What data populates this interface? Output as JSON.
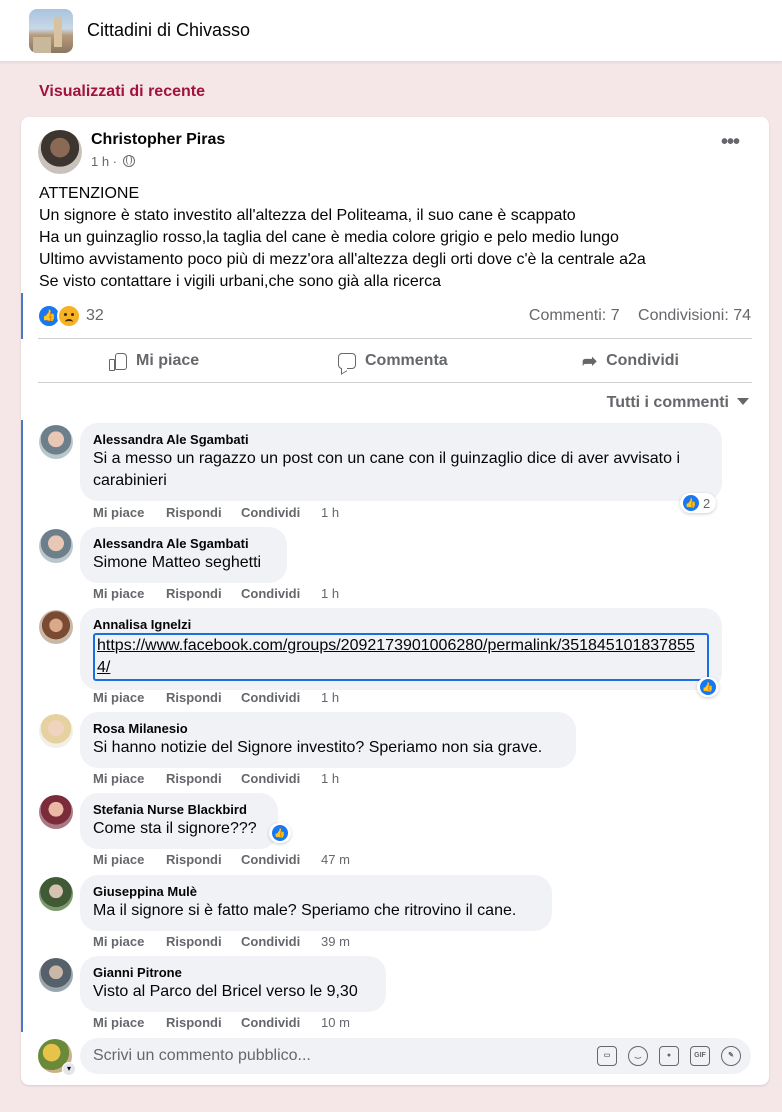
{
  "header": {
    "group_name": "Cittadini di Chivasso"
  },
  "section_label": "Visualizzati di recente",
  "post": {
    "author": "Christopher Piras",
    "time": "1 h ·",
    "lines": [
      "ATTENZIONE",
      "Un signore è stato investito all'altezza del Politeama, il suo cane è scappato",
      "Ha un guinzaglio rosso,la taglia del cane è media colore grigio e pelo medio lungo",
      "Ultimo avvistamento poco più di mezz'ora all'altezza degli orti dove c'è la centrale a2a",
      "Se visto contattare i vigili urbani,che sono già alla ricerca"
    ],
    "reaction_count": "32",
    "comments_stat": "Commenti: 7",
    "shares_stat": "Condivisioni: 74"
  },
  "actions": {
    "like": "Mi piace",
    "comment": "Commenta",
    "share": "Condividi"
  },
  "filter_label": "Tutti i commenti",
  "comment_actions": {
    "like": "Mi piace",
    "reply": "Rispondi",
    "share": "Condividi"
  },
  "comments": [
    {
      "author": "Alessandra Ale Sgambati",
      "text": "Si a messo un ragazzo un post con un cane con il guinzaglio dice di aver avvisato i carabinieri",
      "time": "1 h",
      "reactions": "2"
    },
    {
      "author": "Alessandra Ale Sgambati",
      "text": "Simone Matteo seghetti",
      "time": "1 h"
    },
    {
      "author": "Annalisa Ignelzi",
      "text": "https://www.facebook.com/groups/2092173901006280/permalink/3518451018378554/",
      "time": "1 h"
    },
    {
      "author": "Rosa Milanesio",
      "text": "Si hanno notizie del Signore investito? Speriamo non sia grave.",
      "time": "1 h"
    },
    {
      "author": "Stefania Nurse Blackbird",
      "text": "Come sta il signore???",
      "time": "47 m"
    },
    {
      "author": "Giuseppina Mulè",
      "text": "Ma il signore si è fatto male? Speriamo che ritrovino il cane.",
      "time": "39 m"
    },
    {
      "author": "Gianni Pitrone",
      "text": "Visto al Parco del Bricel verso le 9,30",
      "time": "10 m"
    }
  ],
  "composer": {
    "placeholder": "Scrivi un commento pubblico...",
    "gif_label": "GIF"
  },
  "icons": [
    "globe-icon",
    "more-icon",
    "like-icon",
    "comment-icon",
    "share-icon",
    "caret-icon",
    "sticker-icon",
    "emoji-icon",
    "camera-icon",
    "gif-icon",
    "avatar-sticker-icon"
  ],
  "colors": {
    "accent": "#a1123c",
    "brand": "#1877f2",
    "background": "#f5e6e8"
  }
}
